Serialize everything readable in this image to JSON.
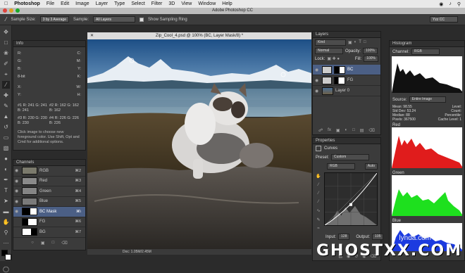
{
  "menubar": {
    "app": "Photoshop",
    "items": [
      "File",
      "Edit",
      "Image",
      "Layer",
      "Type",
      "Select",
      "Filter",
      "3D",
      "View",
      "Window",
      "Help"
    ]
  },
  "window_title": "Adobe Photoshop CC",
  "options_bar": {
    "sample_size_label": "Sample Size:",
    "sample_size_value": "3 by 3 Average",
    "sample_label": "Sample:",
    "sample_value": "All Layers",
    "show_ring_label": "Show Sampling Ring",
    "workspace": "Yzz CC"
  },
  "document": {
    "tab_title": "Zip_Cool_4.psd @ 100% (BC, Layer Mask/8) *",
    "status": "Doc: 1.05M/2.45M"
  },
  "info_panel": {
    "title": "Info",
    "rows": [
      [
        "R:",
        "C:"
      ],
      [
        "G:",
        "M:"
      ],
      [
        "B:",
        "Y:"
      ],
      [
        "8-bit",
        "K:"
      ],
      [
        "X:",
        "W:"
      ],
      [
        "Y:",
        "H:"
      ],
      [
        "#1 R: 241  G: 241  B: 241",
        "#2 R: 162  G: 162  B: 162"
      ],
      [
        "#3 R: 230  G: 230  B: 230",
        "#4 R: 226  G: 226  B: 226"
      ]
    ],
    "help": "Click image to choose new foreground color. Use Shift, Opt and Cmd for additional options."
  },
  "channels_panel": {
    "title": "Channels",
    "rows": [
      {
        "name": "RGB",
        "shortcut": "⌘2"
      },
      {
        "name": "Red",
        "shortcut": "⌘3"
      },
      {
        "name": "Green",
        "shortcut": "⌘4"
      },
      {
        "name": "Blue",
        "shortcut": "⌘5"
      },
      {
        "name": "BC Mask",
        "shortcut": "⌘\\"
      },
      {
        "name": "FG",
        "shortcut": "⌘6"
      },
      {
        "name": "BG",
        "shortcut": "⌘7"
      }
    ]
  },
  "layers_panel": {
    "title": "Layers",
    "kind": "Kind",
    "blend": "Normal",
    "opacity_label": "Opacity:",
    "opacity": "100%",
    "lock_label": "Lock:",
    "fill_label": "Fill:",
    "fill": "100%",
    "layers": [
      {
        "name": "BC"
      },
      {
        "name": "FG"
      },
      {
        "name": "Layer 0"
      }
    ]
  },
  "properties_panel": {
    "title": "Properties",
    "type": "Curves",
    "preset_label": "Preset:",
    "preset": "Custom",
    "channel": "RGB",
    "auto": "Auto",
    "input_label": "Input:",
    "input": "128",
    "output_label": "Output:",
    "output": "105"
  },
  "histogram_panel": {
    "title": "Histogram",
    "channel_label": "Channel:",
    "channel": "RGB",
    "source_label": "Source:",
    "source": "Entire Image",
    "stats_left": [
      "Mean: 98.55",
      "Std Dev: 53.24",
      "Median: 88",
      "Pixels: 367500"
    ],
    "stats_right": [
      "Level:",
      "Count:",
      "Percentile:",
      "Cache Level: 1"
    ],
    "labels": [
      "Red",
      "Green",
      "Blue"
    ],
    "colors": {
      "red": "#e01c1c",
      "green": "#1ee01e",
      "blue": "#1c3be0"
    }
  },
  "watermark": {
    "brand": "GHOSTXX.COM",
    "site": "lynda.com"
  }
}
